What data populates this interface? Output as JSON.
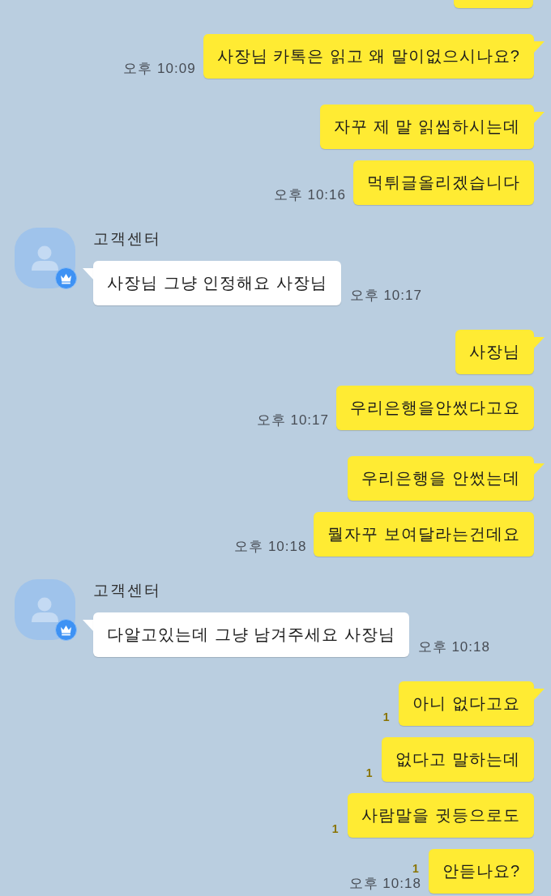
{
  "chat": {
    "groups": [
      {
        "kind": "clipped"
      },
      {
        "kind": "sent",
        "time": "오후 10:09",
        "messages": [
          {
            "text": "사장님 카톡은 읽고 왜 말이없으시나요?"
          }
        ]
      },
      {
        "kind": "sent",
        "time": "오후 10:16",
        "messages": [
          {
            "text": "자꾸 제 말 읽씹하시는데"
          },
          {
            "text": "먹튀글올리겠습니다"
          }
        ]
      },
      {
        "kind": "received",
        "sender": "고객센터",
        "time": "오후 10:17",
        "messages": [
          {
            "text": "사장님 그냥 인정해요 사장님"
          }
        ]
      },
      {
        "kind": "sent",
        "time": "오후 10:17",
        "messages": [
          {
            "text": "사장님"
          },
          {
            "text": "우리은행을안썼다고요"
          }
        ]
      },
      {
        "kind": "sent",
        "time": "오후 10:18",
        "messages": [
          {
            "text": "우리은행을 안썼는데"
          },
          {
            "text": "뭘자꾸 보여달라는건데요"
          }
        ]
      },
      {
        "kind": "received",
        "sender": "고객센터",
        "time": "오후 10:18",
        "messages": [
          {
            "text": "다알고있는데 그냥 남겨주세요 사장님"
          }
        ]
      },
      {
        "kind": "sent",
        "time": "오후 10:18",
        "messages": [
          {
            "text": "아니 없다고요",
            "unread": "1"
          },
          {
            "text": "없다고 말하는데",
            "unread": "1"
          },
          {
            "text": "사람말을 귓등으로도",
            "unread": "1"
          },
          {
            "text": "안듣나요?",
            "unread": "1"
          }
        ]
      }
    ]
  }
}
